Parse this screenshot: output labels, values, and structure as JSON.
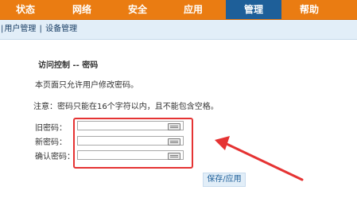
{
  "nav": {
    "tabs": [
      "状态",
      "网络",
      "安全",
      "应用",
      "管理",
      "帮助"
    ],
    "active": "管理"
  },
  "subnav": {
    "items": [
      "用户管理",
      "设备管理"
    ]
  },
  "main": {
    "title": "访问控制 -- 密码",
    "description": "本页面只允许用户修改密码。",
    "note": "注意：密码只能在16个字符以内，且不能包含空格。",
    "fields": [
      {
        "label": "旧密码：",
        "value": ""
      },
      {
        "label": "新密码：",
        "value": ""
      },
      {
        "label": "确认密码：",
        "value": ""
      }
    ],
    "save_label": "保存/应用"
  },
  "colors": {
    "nav_orange": "#ea7c12",
    "nav_active_blue": "#1e5f99",
    "subnav_bg": "#e2eef8",
    "annotation_red": "#e53333"
  },
  "icons": {
    "field_icon": "keyboard-icon",
    "annotation": "arrow-annotation"
  }
}
